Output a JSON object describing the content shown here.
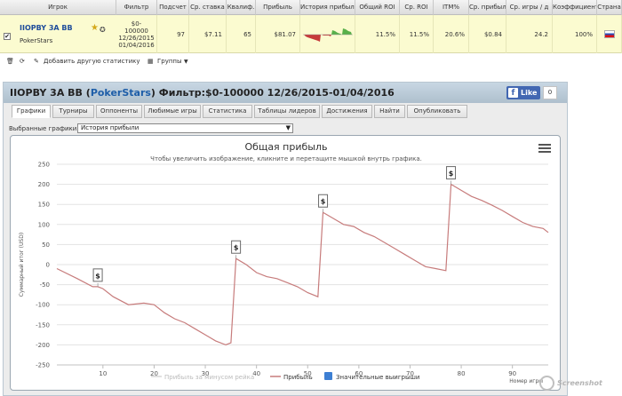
{
  "stats_table": {
    "columns": [
      "Игрок",
      "Фильтр",
      "Подсчет",
      "Ср. ставка",
      "Квалиф.",
      "Прибыль",
      "История прибыли",
      "Общий ROI",
      "Ср. ROI",
      "ITM%",
      "Ср. прибыль",
      "Ср. игры / д",
      "Коэффициент",
      "Страна"
    ],
    "row": {
      "checked": "✔",
      "player": "IIOPBY 3A BB",
      "site": "PokerStars",
      "filter": "$0-\n100000\n12/26/2015\n01/04/2016",
      "count": "97",
      "avg_stake": "$7.11",
      "qualifications": "65",
      "profit": "$81.07",
      "total_roi": "11.5%",
      "avg_roi": "11.5%",
      "itm": "20.6%",
      "avg_profit": "$0.84",
      "games_per_day": "24.2",
      "ratio": "100%"
    },
    "toolbar": {
      "add_stat": "Добавить другую статистику",
      "groups": "Группы"
    }
  },
  "report": {
    "title_player": "IIOPBY 3A BB",
    "title_site": "PokerStars",
    "title_filter": "Фильтр:$0-100000 12/26/2015-01/04/2016",
    "fb_like": "Like",
    "fb_count": "0",
    "tabs": [
      "Графики",
      "Турниры",
      "Оппоненты",
      "Любимые игры",
      "Статистика",
      "Таблицы лидеров",
      "Достижения",
      "Найти",
      "Опубликовать"
    ],
    "selector_label": "Выбранные графики:",
    "selector_value": "История прибыли"
  },
  "chart_data": {
    "type": "line",
    "title": "Общая прибыль",
    "subtitle": "Чтобы увеличить изображение, кликните и перетащите мышкой внутрь графика.",
    "xlabel": "Номер игры",
    "ylabel": "Суммарный итог (USD)",
    "xlim": [
      1,
      97
    ],
    "ylim": [
      -250,
      250
    ],
    "x_ticks": [
      10,
      20,
      30,
      40,
      50,
      60,
      70,
      80,
      90
    ],
    "y_ticks": [
      250,
      200,
      150,
      100,
      50,
      0,
      -50,
      -100,
      -150,
      -200,
      -250
    ],
    "grid": true,
    "legend_position": "bottom",
    "series": [
      {
        "name": "Прибыль за минусом рейка",
        "color": "#d6d6d6",
        "visible": false,
        "x": [],
        "y": []
      },
      {
        "name": "Прибыль",
        "color": "#c77c7c",
        "x": [
          1,
          5,
          8,
          9,
          10,
          12,
          15,
          18,
          20,
          22,
          24,
          26,
          28,
          30,
          32,
          34,
          35,
          36,
          38,
          40,
          42,
          44,
          46,
          48,
          50,
          52,
          53,
          55,
          57,
          59,
          61,
          63,
          65,
          67,
          69,
          71,
          73,
          75,
          77,
          78,
          80,
          82,
          84,
          86,
          88,
          90,
          92,
          94,
          96,
          97
        ],
        "y": [
          -10,
          -35,
          -55,
          -55,
          -60,
          -80,
          -100,
          -96,
          -100,
          -120,
          -135,
          -145,
          -160,
          -175,
          -190,
          -200,
          -195,
          15,
          0,
          -20,
          -30,
          -35,
          -45,
          -55,
          -70,
          -80,
          130,
          115,
          100,
          95,
          80,
          70,
          55,
          40,
          25,
          10,
          -5,
          -10,
          -15,
          200,
          185,
          170,
          160,
          148,
          135,
          120,
          105,
          95,
          90,
          80
        ]
      }
    ],
    "markers": {
      "series_name": "Значительные выигрыши",
      "color": "#3d7fd3",
      "label": "$",
      "points": [
        {
          "x": 9,
          "y": -55
        },
        {
          "x": 36,
          "y": 15
        },
        {
          "x": 53,
          "y": 130
        },
        {
          "x": 78,
          "y": 200
        }
      ]
    }
  },
  "colors": {
    "row_highlight": "#fbfbd0",
    "titlebar": "#b8c8d6",
    "site_link": "#1e5ea8",
    "facebook": "#4267b2"
  },
  "watermark": "Screenshot"
}
